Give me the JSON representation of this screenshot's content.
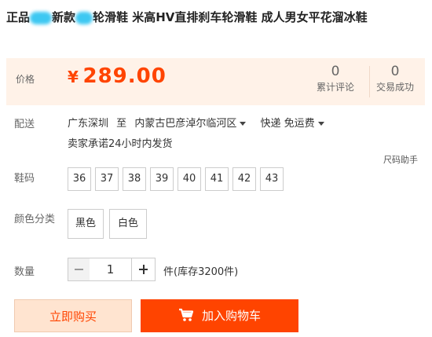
{
  "product": {
    "title_part1": "正品",
    "title_part2": "新款",
    "title_part3": "轮滑鞋 米高HV直排刹车轮滑鞋 成人男女平花溜冰鞋"
  },
  "price_box": {
    "label": "价格",
    "currency": "¥",
    "price": "289.00",
    "reviews_count": "0",
    "reviews_label": "累计评论",
    "deals_count": "0",
    "deals_label": "交易成功"
  },
  "shipping": {
    "label": "配送",
    "from": "广东深圳",
    "to_word": "至",
    "destination": "内蒙古巴彦淖尔临河区",
    "method": "快递 免运费",
    "promise": "卖家承诺24小时内发货",
    "size_help": "尺码助手"
  },
  "size": {
    "label": "鞋码",
    "options": [
      "36",
      "37",
      "38",
      "39",
      "40",
      "41",
      "42",
      "43"
    ]
  },
  "color": {
    "label": "颜色分类",
    "options": [
      "黑色",
      "白色"
    ]
  },
  "quantity": {
    "label": "数量",
    "value": "1",
    "stock": "件(库存3200件)"
  },
  "actions": {
    "buy_now": "立即购买",
    "add_cart": "加入购物车"
  },
  "colors": {
    "accent": "#ff4400",
    "price_bg": "#fff2e8",
    "buy_now_bg": "#ffe4d0"
  }
}
